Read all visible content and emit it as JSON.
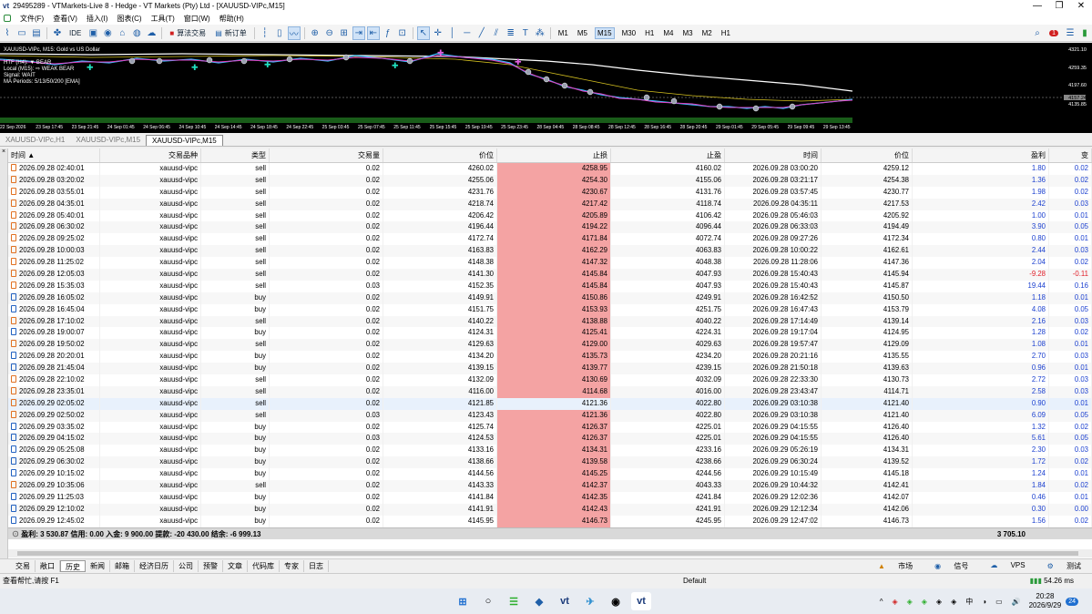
{
  "window": {
    "title": "29495289 - VTMarkets-Live 8 - Hedge - VT Markets (Pty) Ltd - [XAUUSD-VIPc,M15]",
    "logo": "vt",
    "min": "—",
    "max": "❐",
    "close": "✕"
  },
  "menu": [
    "文件(F)",
    "查看(V)",
    "插入(I)",
    "图表(C)",
    "工具(T)",
    "窗口(W)",
    "帮助(H)"
  ],
  "toolbar": {
    "ide": "IDE",
    "algo": "算法交易",
    "neworder": "新订单",
    "timeframes": [
      "M1",
      "M5",
      "M15",
      "M30",
      "H1",
      "M4",
      "M3",
      "M2",
      "H1"
    ],
    "active_tf": "M15",
    "alert_count": "1"
  },
  "chart": {
    "info": [
      "XAUUSD-VIPc, M15: Gold vs US Dollar",
      "HTF (H4): ▼ BEAR",
      "Local (M15): ⇨ WEAK BEAR",
      "Signal: WAIT",
      "MA Periods: 5/13/50/200 [EMA]"
    ],
    "yticks": [
      "4321.10",
      "4259.35",
      "4197.60",
      "4157.24",
      "4135.85"
    ],
    "xticks": [
      "22 Sep 2026",
      "23 Sep 17:45",
      "23 Sep 21:45",
      "24 Sep 01:45",
      "24 Sep 06:45",
      "24 Sep 10:45",
      "24 Sep 14:45",
      "24 Sep 18:45",
      "24 Sep 22:45",
      "25 Sep 03:45",
      "25 Sep 07:45",
      "25 Sep 11:45",
      "25 Sep 15:45",
      "25 Sep 19:45",
      "25 Sep 23:45",
      "28 Sep 04:45",
      "28 Sep 08:45",
      "28 Sep 12:45",
      "28 Sep 16:45",
      "28 Sep 20:45",
      "29 Sep 01:45",
      "29 Sep 05:45",
      "29 Sep 09:45",
      "29 Sep 13:45"
    ]
  },
  "chart_tabs": [
    "XAUUSD-VIPc,H1",
    "XAUUSD-VIPc,M15",
    "XAUUSD-VIPc,M15"
  ],
  "left_strip": "×",
  "columns": [
    "时间 ▲",
    "交易品种",
    "类型",
    "交易量",
    "价位",
    "止损",
    "止盈",
    "时间",
    "价位",
    "盈利",
    "变"
  ],
  "rows": [
    [
      "2026.09.28 02:40:01",
      "xauusd-vipc",
      "sell",
      "0.02",
      "4260.02",
      "4258.95",
      "4160.02",
      "2026.09.28 03:00:20",
      "4259.12",
      "1.80",
      "0.02"
    ],
    [
      "2026.09.28 03:20:02",
      "xauusd-vipc",
      "sell",
      "0.02",
      "4255.06",
      "4254.30",
      "4155.06",
      "2026.09.28 03:21:17",
      "4254.38",
      "1.36",
      "0.02"
    ],
    [
      "2026.09.28 03:55:01",
      "xauusd-vipc",
      "sell",
      "0.02",
      "4231.76",
      "4230.67",
      "4131.76",
      "2026.09.28 03:57:45",
      "4230.77",
      "1.98",
      "0.02"
    ],
    [
      "2026.09.28 04:35:01",
      "xauusd-vipc",
      "sell",
      "0.02",
      "4218.74",
      "4217.42",
      "4118.74",
      "2026.09.28 04:35:11",
      "4217.53",
      "2.42",
      "0.03"
    ],
    [
      "2026.09.28 05:40:01",
      "xauusd-vipc",
      "sell",
      "0.02",
      "4206.42",
      "4205.89",
      "4106.42",
      "2026.09.28 05:46:03",
      "4205.92",
      "1.00",
      "0.01"
    ],
    [
      "2026.09.28 06:30:02",
      "xauusd-vipc",
      "sell",
      "0.02",
      "4196.44",
      "4194.22",
      "4096.44",
      "2026.09.28 06:33:03",
      "4194.49",
      "3.90",
      "0.05"
    ],
    [
      "2026.09.28 09:25:02",
      "xauusd-vipc",
      "sell",
      "0.02",
      "4172.74",
      "4171.84",
      "4072.74",
      "2026.09.28 09:27:26",
      "4172.34",
      "0.80",
      "0.01"
    ],
    [
      "2026.09.28 10:00:03",
      "xauusd-vipc",
      "sell",
      "0.02",
      "4163.83",
      "4162.29",
      "4063.83",
      "2026.09.28 10:00:22",
      "4162.61",
      "2.44",
      "0.03"
    ],
    [
      "2026.09.28 11:25:02",
      "xauusd-vipc",
      "sell",
      "0.02",
      "4148.38",
      "4147.32",
      "4048.38",
      "2026.09.28 11:28:06",
      "4147.36",
      "2.04",
      "0.02"
    ],
    [
      "2026.09.28 12:05:03",
      "xauusd-vipc",
      "sell",
      "0.02",
      "4141.30",
      "4145.84",
      "4047.93",
      "2026.09.28 15:40:43",
      "4145.94",
      "-9.28",
      "-0.11"
    ],
    [
      "2026.09.28 15:35:03",
      "xauusd-vipc",
      "sell",
      "0.03",
      "4152.35",
      "4145.84",
      "4047.93",
      "2026.09.28 15:40:43",
      "4145.87",
      "19.44",
      "0.16"
    ],
    [
      "2026.09.28 16:05:02",
      "xauusd-vipc",
      "buy",
      "0.02",
      "4149.91",
      "4150.86",
      "4249.91",
      "2026.09.28 16:42:52",
      "4150.50",
      "1.18",
      "0.01"
    ],
    [
      "2026.09.28 16:45:04",
      "xauusd-vipc",
      "buy",
      "0.02",
      "4151.75",
      "4153.93",
      "4251.75",
      "2026.09.28 16:47:43",
      "4153.79",
      "4.08",
      "0.05"
    ],
    [
      "2026.09.28 17:10:02",
      "xauusd-vipc",
      "sell",
      "0.02",
      "4140.22",
      "4138.88",
      "4040.22",
      "2026.09.28 17:14:49",
      "4139.14",
      "2.16",
      "0.03"
    ],
    [
      "2026.09.28 19:00:07",
      "xauusd-vipc",
      "buy",
      "0.02",
      "4124.31",
      "4125.41",
      "4224.31",
      "2026.09.28 19:17:04",
      "4124.95",
      "1.28",
      "0.02"
    ],
    [
      "2026.09.28 19:50:02",
      "xauusd-vipc",
      "sell",
      "0.02",
      "4129.63",
      "4129.00",
      "4029.63",
      "2026.09.28 19:57:47",
      "4129.09",
      "1.08",
      "0.01"
    ],
    [
      "2026.09.28 20:20:01",
      "xauusd-vipc",
      "buy",
      "0.02",
      "4134.20",
      "4135.73",
      "4234.20",
      "2026.09.28 20:21:16",
      "4135.55",
      "2.70",
      "0.03"
    ],
    [
      "2026.09.28 21:45:04",
      "xauusd-vipc",
      "buy",
      "0.02",
      "4139.15",
      "4139.77",
      "4239.15",
      "2026.09.28 21:50:18",
      "4139.63",
      "0.96",
      "0.01"
    ],
    [
      "2026.09.28 22:10:02",
      "xauusd-vipc",
      "sell",
      "0.02",
      "4132.09",
      "4130.69",
      "4032.09",
      "2026.09.28 22:33:30",
      "4130.73",
      "2.72",
      "0.03"
    ],
    [
      "2026.09.28 23:35:01",
      "xauusd-vipc",
      "sell",
      "0.02",
      "4116.00",
      "4114.68",
      "4016.00",
      "2026.09.28 23:43:47",
      "4114.71",
      "2.58",
      "0.03"
    ],
    [
      "2026.09.29 02:05:02",
      "xauusd-vipc",
      "sell",
      "0.02",
      "4121.85",
      "4121.36",
      "4022.80",
      "2026.09.29 03:10:38",
      "4121.40",
      "0.90",
      "0.01"
    ],
    [
      "2026.09.29 02:50:02",
      "xauusd-vipc",
      "sell",
      "0.03",
      "4123.43",
      "4121.36",
      "4022.80",
      "2026.09.29 03:10:38",
      "4121.40",
      "6.09",
      "0.05"
    ],
    [
      "2026.09.29 03:35:02",
      "xauusd-vipc",
      "buy",
      "0.02",
      "4125.74",
      "4126.37",
      "4225.01",
      "2026.09.29 04:15:55",
      "4126.40",
      "1.32",
      "0.02"
    ],
    [
      "2026.09.29 04:15:02",
      "xauusd-vipc",
      "buy",
      "0.03",
      "4124.53",
      "4126.37",
      "4225.01",
      "2026.09.29 04:15:55",
      "4126.40",
      "5.61",
      "0.05"
    ],
    [
      "2026.09.29 05:25:08",
      "xauusd-vipc",
      "buy",
      "0.02",
      "4133.16",
      "4134.31",
      "4233.16",
      "2026.09.29 05:26:19",
      "4134.31",
      "2.30",
      "0.03"
    ],
    [
      "2026.09.29 06:30:02",
      "xauusd-vipc",
      "buy",
      "0.02",
      "4138.66",
      "4139.58",
      "4238.66",
      "2026.09.29 06:30:24",
      "4139.52",
      "1.72",
      "0.02"
    ],
    [
      "2026.09.29 10:15:02",
      "xauusd-vipc",
      "buy",
      "0.02",
      "4144.56",
      "4145.25",
      "4244.56",
      "2026.09.29 10:15:49",
      "4145.18",
      "1.24",
      "0.01"
    ],
    [
      "2026.09.29 10:35:06",
      "xauusd-vipc",
      "sell",
      "0.02",
      "4143.33",
      "4142.37",
      "4043.33",
      "2026.09.29 10:44:32",
      "4142.41",
      "1.84",
      "0.02"
    ],
    [
      "2026.09.29 11:25:03",
      "xauusd-vipc",
      "buy",
      "0.02",
      "4141.84",
      "4142.35",
      "4241.84",
      "2026.09.29 12:02:36",
      "4142.07",
      "0.46",
      "0.01"
    ],
    [
      "2026.09.29 12:10:02",
      "xauusd-vipc",
      "buy",
      "0.02",
      "4141.91",
      "4142.43",
      "4241.91",
      "2026.09.29 12:12:34",
      "4142.06",
      "0.30",
      "0.00"
    ],
    [
      "2026.09.29 12:45:02",
      "xauusd-vipc",
      "buy",
      "0.02",
      "4145.95",
      "4146.73",
      "4245.95",
      "2026.09.29 12:47:02",
      "4146.73",
      "1.56",
      "0.02"
    ]
  ],
  "totals": {
    "summary": "盈利: 3 530.87  信用: 0.00  入金: 9 900.00  提款: -20 430.00  结余: -6 999.13",
    "profit": "3 705.10"
  },
  "bottom_tabs": [
    "交易",
    "敞口",
    "历史",
    "新闻",
    "邮箱",
    "经济日历",
    "公司",
    "预警",
    "文章",
    "代码库",
    "专家",
    "日志"
  ],
  "active_bottom_tab": "历史",
  "bottom_right": [
    "市场",
    "信号",
    "VPS",
    "测试"
  ],
  "status": {
    "help": "查看帮忙,请按 F1",
    "profile": "Default",
    "ping": "54.26 ms"
  },
  "taskbar": {
    "apps": [
      "⊞",
      "○",
      "☰",
      "◆",
      "vt",
      "✈",
      "◉",
      "vt"
    ],
    "tray": [
      "^",
      "中",
      "◑",
      "🔊"
    ],
    "time": "20:28",
    "date": "2026/9/29",
    "badge": "24"
  }
}
